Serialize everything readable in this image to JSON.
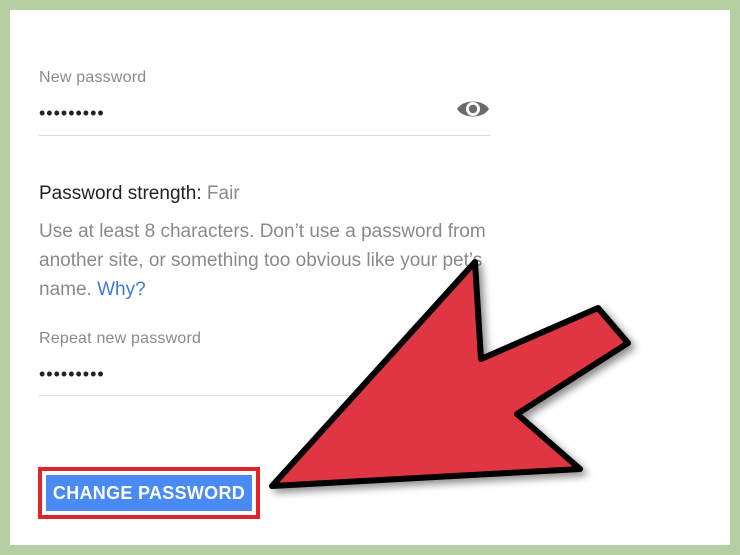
{
  "form": {
    "new_password": {
      "label": "New password",
      "value": "•••••••••",
      "visibility_toggle_icon": "eye-icon"
    },
    "strength": {
      "label": "Password strength:",
      "value": "Fair"
    },
    "help": {
      "text": "Use at least 8 characters. Don’t use a password from another site, or something too obvious like your pet’s name.",
      "link_label": "Why?"
    },
    "repeat_password": {
      "label": "Repeat new password",
      "value": "•••••••••"
    },
    "submit_label": "CHANGE PASSWORD"
  },
  "annotation": {
    "arrow_color": "#e03543",
    "outline_color": "#e1242c"
  },
  "colors": {
    "frame": "#b5cfa3",
    "button": "#4a8af4",
    "link": "#3f7bd8"
  }
}
